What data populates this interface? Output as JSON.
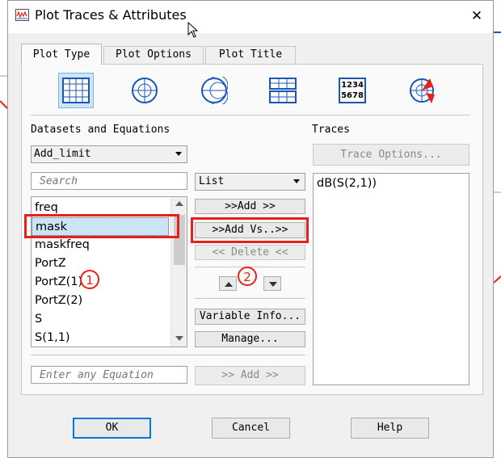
{
  "window": {
    "title": "Plot Traces & Attributes"
  },
  "tabs": [
    {
      "label": "Plot Type"
    },
    {
      "label": "Plot Options"
    },
    {
      "label": "Plot Title"
    }
  ],
  "plot_types": [
    {
      "icon": "rectangular-grid-icon",
      "selected": true
    },
    {
      "icon": "polar-plot-icon",
      "selected": false
    },
    {
      "icon": "smith-chart-icon",
      "selected": false
    },
    {
      "icon": "stacked-rectangular-icon",
      "selected": false
    },
    {
      "icon": "list-numbers-icon",
      "text": "1234 5678"
    },
    {
      "icon": "antenna-plot-icon",
      "selected": false
    }
  ],
  "datasets": {
    "heading": "Datasets and Equations",
    "dataset_value": "Add_limit",
    "search_placeholder": "Search",
    "view_mode": "List",
    "items": [
      "freq",
      "mask",
      "maskfreq",
      "PortZ",
      "PortZ(1)",
      "PortZ(2)",
      "S",
      "S(1,1)"
    ],
    "selected_item": "mask"
  },
  "buttons": {
    "add": ">>Add >>",
    "add_vs": ">>Add Vs..>>",
    "delete": "<< Delete <<",
    "variable_info": "Variable Info...",
    "manage": "Manage...",
    "add_equation": ">> Add >>",
    "trace_options": "Trace Options...",
    "ok": "OK",
    "cancel": "Cancel",
    "help": "Help"
  },
  "equation": {
    "placeholder": "Enter any Equation"
  },
  "traces": {
    "heading": "Traces",
    "items": [
      "dB(S(2,1))"
    ]
  },
  "annotations": [
    "1",
    "2"
  ],
  "colors": {
    "highlight": "#e8201a",
    "selection": "#cce4f7",
    "icon_blue": "#1a56b4"
  }
}
